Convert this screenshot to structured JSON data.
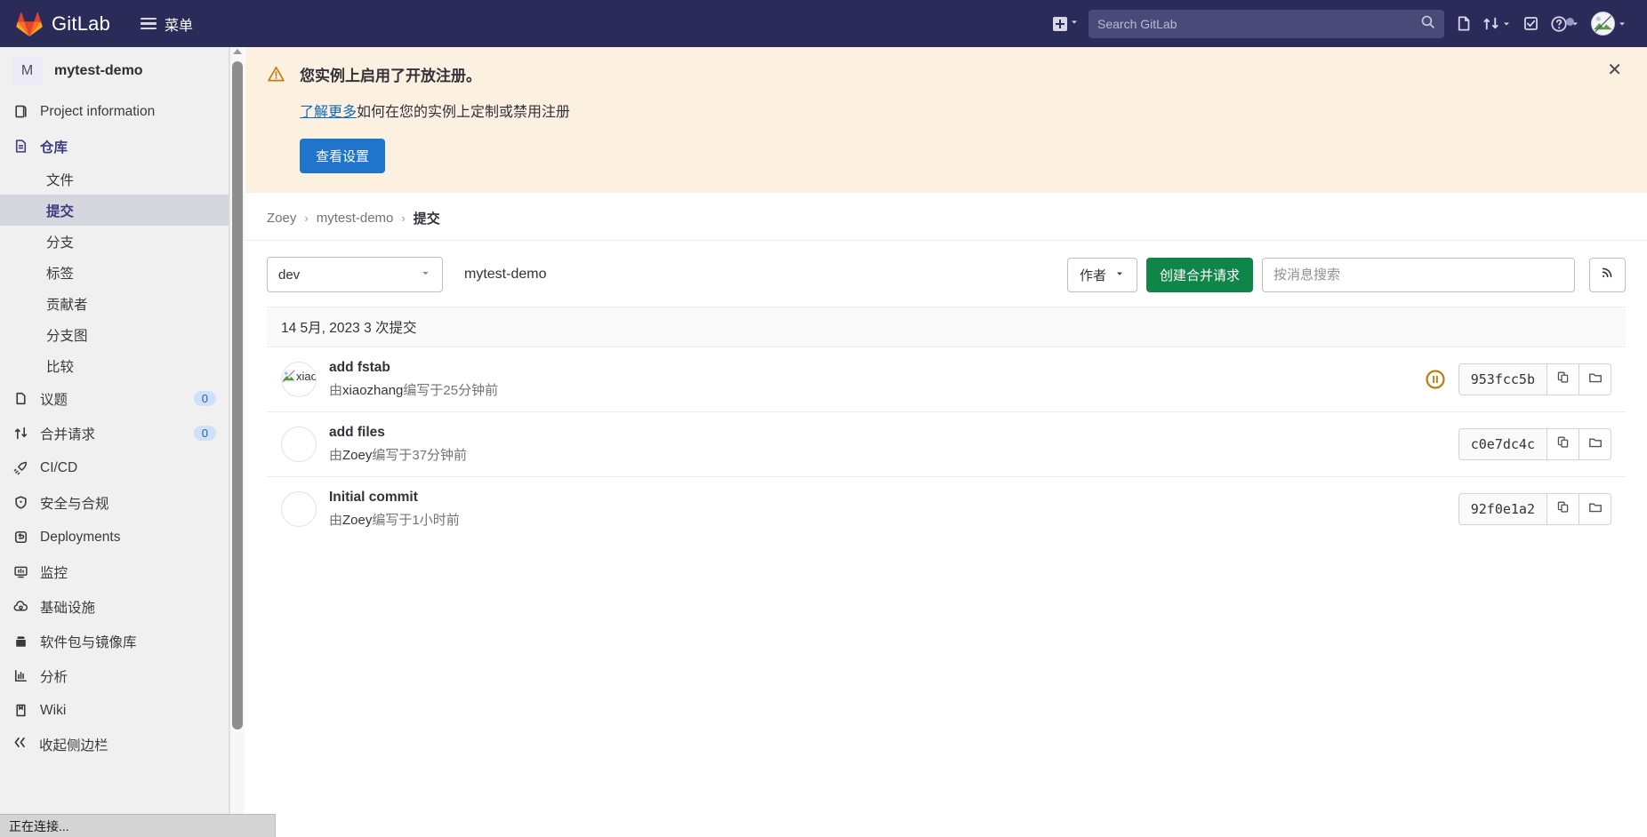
{
  "topnav": {
    "brand": "GitLab",
    "menu_label": "菜单",
    "new_icon": "plus-square-icon",
    "new_chevron": "chevron-down-icon",
    "search_placeholder": "Search GitLab",
    "search_icon": "search-icon",
    "issues_icon": "issues-icon",
    "merge_requests_icon": "merge-request-icon",
    "todos_icon": "todo-check-icon",
    "help_icon": "help-question-icon",
    "avatar_icon": "user-avatar"
  },
  "sidebar": {
    "project_initial": "M",
    "project_name": "mytest-demo",
    "items": [
      {
        "label": "Project information",
        "icon": "project-info-icon",
        "type": "top"
      },
      {
        "label": "仓库",
        "icon": "repository-doc-icon",
        "type": "top-active"
      },
      {
        "label": "文件",
        "type": "sub"
      },
      {
        "label": "提交",
        "type": "sub-selected"
      },
      {
        "label": "分支",
        "type": "sub"
      },
      {
        "label": "标签",
        "type": "sub"
      },
      {
        "label": "贡献者",
        "type": "sub"
      },
      {
        "label": "分支图",
        "type": "sub"
      },
      {
        "label": "比较",
        "type": "sub"
      },
      {
        "label": "议题",
        "icon": "issues-icon",
        "type": "top",
        "count": "0"
      },
      {
        "label": "合并请求",
        "icon": "merge-request-icon",
        "type": "top",
        "count": "0"
      },
      {
        "label": "CI/CD",
        "icon": "rocket-icon",
        "type": "top"
      },
      {
        "label": "安全与合规",
        "icon": "shield-icon",
        "type": "top"
      },
      {
        "label": "Deployments",
        "icon": "deployments-icon",
        "type": "top"
      },
      {
        "label": "监控",
        "icon": "monitor-icon",
        "type": "top"
      },
      {
        "label": "基础设施",
        "icon": "infrastructure-cloud-icon",
        "type": "top"
      },
      {
        "label": "软件包与镜像库",
        "icon": "package-icon",
        "type": "top"
      },
      {
        "label": "分析",
        "icon": "analytics-chart-icon",
        "type": "top"
      },
      {
        "label": "Wiki",
        "icon": "wiki-book-icon",
        "type": "top"
      }
    ],
    "collapse_label": "收起侧边栏",
    "collapse_icon": "collapse-arrows-icon"
  },
  "alert": {
    "warning_icon": "warning-triangle-icon",
    "title": "您实例上启用了开放注册。",
    "link_text": "了解更多",
    "sub_rest": "如何在您的实例上定制或禁用注册",
    "button_label": "查看设置",
    "close_icon": "close-x-icon",
    "bg_color": "#fcf1e1",
    "button_color": "#1f75cb"
  },
  "breadcrumb": {
    "items": [
      {
        "label": "Zoey"
      },
      {
        "label": "mytest-demo"
      },
      {
        "label": "提交"
      }
    ],
    "separator": "›"
  },
  "toolbar": {
    "branch": "dev",
    "branch_chevron": "chevron-down-icon",
    "repo_label": "mytest-demo",
    "author_label": "作者",
    "author_chevron": "chevron-down-icon",
    "create_mr_label": "创建合并请求",
    "create_mr_color": "#108548",
    "search_placeholder": "按消息搜索",
    "search_value": "",
    "rss_icon": "rss-feed-icon"
  },
  "commits": {
    "date_header": "14 5月, 2023 3 次提交",
    "copy_icon": "copy-clipboard-icon",
    "browse_icon": "browse-files-folder-icon",
    "rows": [
      {
        "title": "add fstab",
        "meta_prefix": "由",
        "author": "xiaozhang",
        "meta_suffix": "编写于25分钟前",
        "sha": "953fcc5b",
        "avatar_state": "broken-image",
        "avatar_alt": "xiao",
        "pipeline_status": "pending",
        "pipeline_icon": "pipeline-pending-icon",
        "pipeline_color": "#c17d10"
      },
      {
        "title": "add files",
        "meta_prefix": "由",
        "author": "Zoey",
        "meta_suffix": "编写于37分钟前",
        "sha": "c0e7dc4c",
        "avatar_state": "blank",
        "pipeline_status": "none"
      },
      {
        "title": "Initial commit",
        "meta_prefix": "由",
        "author": "Zoey",
        "meta_suffix": "编写于1小时前",
        "sha": "92f0e1a2",
        "avatar_state": "blank",
        "pipeline_status": "none"
      }
    ]
  },
  "statusbar": {
    "text": "正在连接..."
  }
}
